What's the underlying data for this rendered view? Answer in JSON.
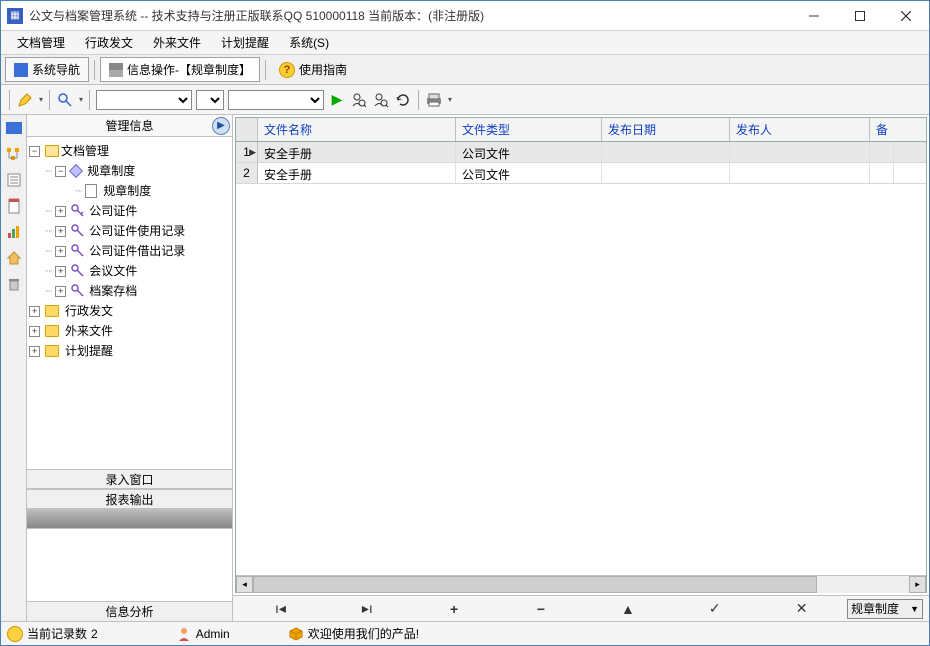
{
  "title": "公文与档案管理系统 -- 技术支持与注册正版联系QQ 510000118    当前版本：(非注册版)",
  "menubar": [
    "文档管理",
    "行政发文",
    "外来文件",
    "计划提醒",
    "系统(S)"
  ],
  "tabs": {
    "nav": "系统导航",
    "info_op": "信息操作-【规章制度】",
    "guide": "使用指南"
  },
  "left": {
    "header": "管理信息",
    "tree": {
      "root": "文档管理",
      "reg1": "规章制度",
      "reg2": "规章制度",
      "cert": "公司证件",
      "cert_use": "公司证件使用记录",
      "cert_borrow": "公司证件借出记录",
      "meeting": "会议文件",
      "archive": "档案存档",
      "admin_doc": "行政发文",
      "external": "外来文件",
      "plan": "计划提醒"
    },
    "sec_input": "录入窗口",
    "sec_report": "报表输出",
    "sec_analysis": "信息分析"
  },
  "grid": {
    "headers": [
      "文件名称",
      "文件类型",
      "发布日期",
      "发布人",
      "备"
    ],
    "rows": [
      {
        "n": "1",
        "name": "安全手册",
        "type": "公司文件",
        "date": "",
        "pub": ""
      },
      {
        "n": "2",
        "name": "安全手册",
        "type": "公司文件",
        "date": "",
        "pub": ""
      }
    ]
  },
  "nav_combo": "规章制度",
  "status": {
    "records_label": "当前记录数",
    "records_value": "2",
    "user": "Admin",
    "welcome": "欢迎使用我们的产品!"
  }
}
